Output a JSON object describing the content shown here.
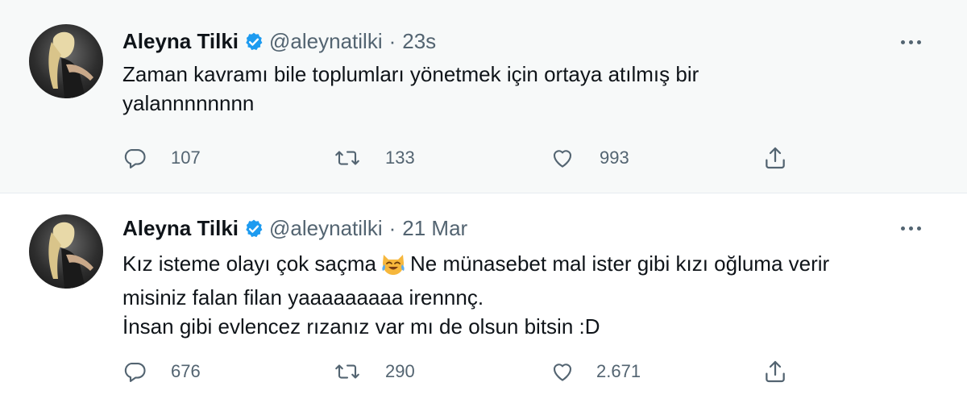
{
  "tweets": [
    {
      "author_name": "Aleyna Tilki",
      "handle": "@aleynatilki",
      "separator": "·",
      "time": "23s",
      "text_lines": [
        "Zaman kavramı bile toplumları yönetmek için ortaya atılmış bir",
        "yalannnnnnnn"
      ],
      "replies": "107",
      "retweets": "133",
      "likes": "993"
    },
    {
      "author_name": "Aleyna Tilki",
      "handle": "@aleynatilki",
      "separator": "·",
      "time": "21 Mar",
      "text_line1_before_emoji": "Kız isteme olayı çok saçma",
      "text_line1_after_emoji": "Ne münasebet mal ister gibi kızı oğluma verir",
      "text_line2": "misiniz falan filan yaaaaaaaaa irennnç.",
      "text_line3": "İnsan gibi evlencez rızanız var mı de olsun bitsin :D",
      "replies": "676",
      "retweets": "290",
      "likes": "2.671"
    }
  ],
  "icons": {
    "verified": "verified-badge-icon",
    "reply": "reply-icon",
    "retweet": "retweet-icon",
    "like": "heart-icon",
    "share": "share-icon",
    "more": "more-icon",
    "emoji": "laughing-crying-cat-emoji"
  },
  "colors": {
    "verified_blue": "#1d9bf0",
    "secondary_text": "#536471",
    "primary_text": "#0f1419",
    "highlight_background": "#f7f9f9"
  }
}
